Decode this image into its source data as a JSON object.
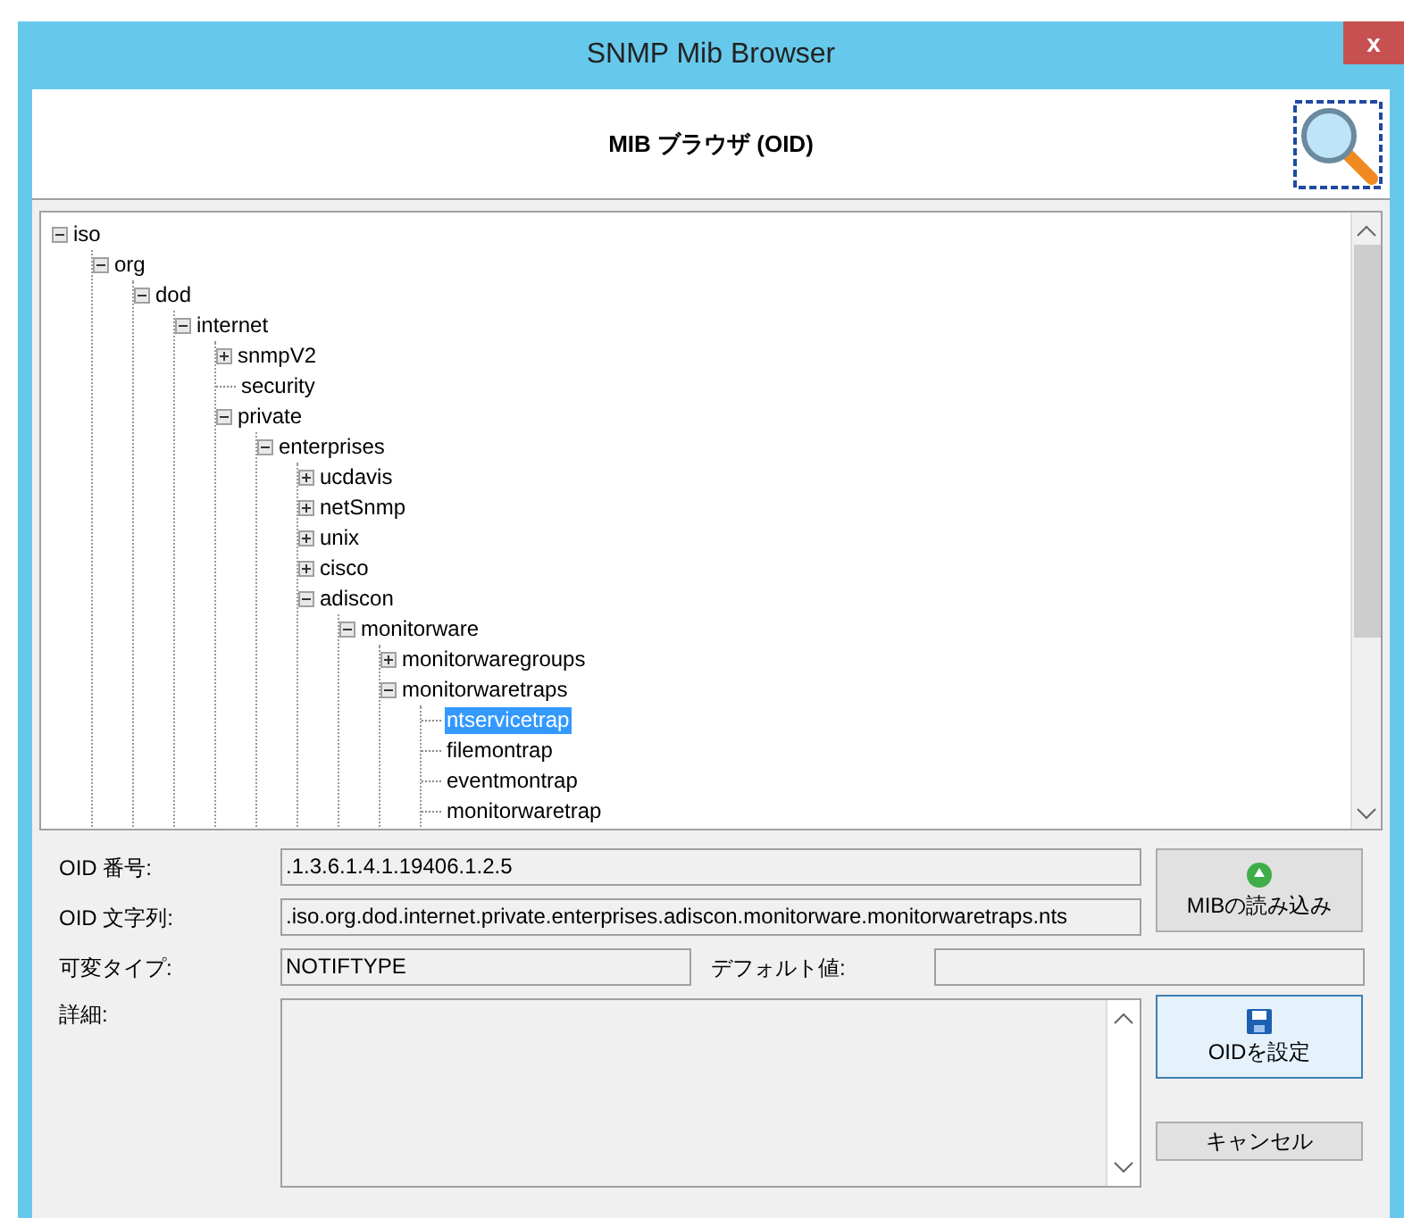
{
  "window": {
    "title": "SNMP Mib Browser",
    "close": "x"
  },
  "header": {
    "title": "MIB ブラウザ (OID)"
  },
  "tree": [
    {
      "label": "iso",
      "expanded": true,
      "selected": false,
      "children": [
        {
          "label": "org",
          "expanded": true,
          "selected": false,
          "children": [
            {
              "label": "dod",
              "expanded": true,
              "selected": false,
              "children": [
                {
                  "label": "internet",
                  "expanded": true,
                  "selected": false,
                  "children": [
                    {
                      "label": "snmpV2",
                      "expanded": false,
                      "selected": false
                    },
                    {
                      "label": "security",
                      "selected": false
                    },
                    {
                      "label": "private",
                      "expanded": true,
                      "selected": false,
                      "children": [
                        {
                          "label": "enterprises",
                          "expanded": true,
                          "selected": false,
                          "children": [
                            {
                              "label": "ucdavis",
                              "expanded": false,
                              "selected": false
                            },
                            {
                              "label": "netSnmp",
                              "expanded": false,
                              "selected": false
                            },
                            {
                              "label": "unix",
                              "expanded": false,
                              "selected": false
                            },
                            {
                              "label": "cisco",
                              "expanded": false,
                              "selected": false
                            },
                            {
                              "label": "adiscon",
                              "expanded": true,
                              "selected": false,
                              "children": [
                                {
                                  "label": "monitorware",
                                  "expanded": true,
                                  "selected": false,
                                  "children": [
                                    {
                                      "label": "monitorwaregroups",
                                      "expanded": false,
                                      "selected": false
                                    },
                                    {
                                      "label": "monitorwaretraps",
                                      "expanded": true,
                                      "selected": false,
                                      "children": [
                                        {
                                          "label": "ntservicetrap",
                                          "selected": true
                                        },
                                        {
                                          "label": "filemontrap",
                                          "selected": false
                                        },
                                        {
                                          "label": "eventmontrap",
                                          "selected": false
                                        },
                                        {
                                          "label": "monitorwaretrap",
                                          "selected": false
                                        }
                                      ]
                                    }
                                  ]
                                }
                              ]
                            }
                          ]
                        }
                      ]
                    }
                  ]
                }
              ]
            }
          ]
        }
      ]
    }
  ],
  "fields": {
    "oid_number": {
      "label": "OID 番号:",
      "value": ".1.3.6.1.4.1.19406.1.2.5"
    },
    "oid_string": {
      "label": "OID 文字列:",
      "value": ".iso.org.dod.internet.private.enterprises.adiscon.monitorware.monitorwaretraps.nts"
    },
    "var_type": {
      "label": "可変タイプ:",
      "value": "NOTIFTYPE"
    },
    "default_value": {
      "label": "デフォルト値:"
    },
    "details": {
      "label": "詳細:"
    }
  },
  "buttons": {
    "load_mib": "MIBの読み込み",
    "set_oid": "OIDを設定",
    "cancel": "キャンセル"
  }
}
